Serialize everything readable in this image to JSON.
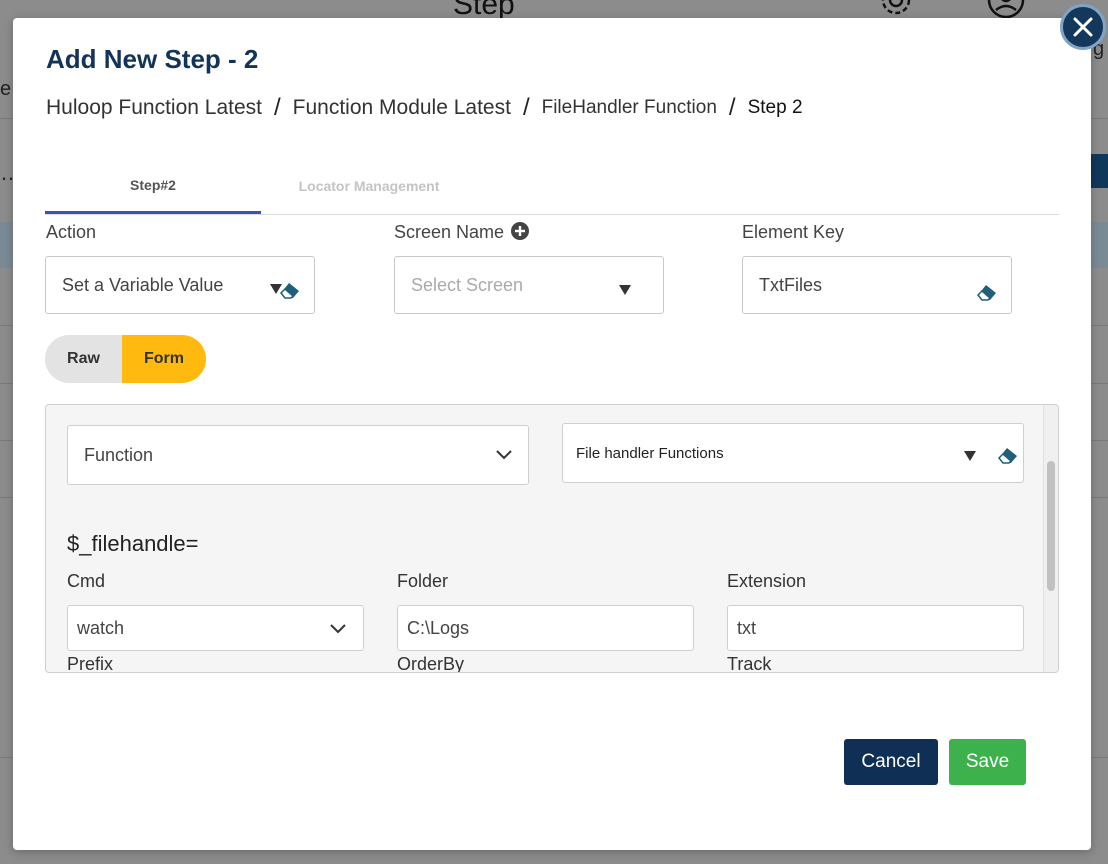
{
  "background": {
    "title": "Step",
    "letter_left": "e",
    "letter_right": "g",
    "dots": "…"
  },
  "modal": {
    "title": "Add New Step - 2",
    "breadcrumb": [
      "Huloop Function Latest",
      "Function Module Latest",
      "FileHandler Function",
      "Step 2"
    ],
    "tabs": [
      "Step#2",
      "Locator Management"
    ],
    "action": {
      "label": "Action",
      "value": "Set a Variable Value"
    },
    "screen_name": {
      "label": "Screen Name",
      "placeholder": "Select Screen"
    },
    "element_key": {
      "label": "Element Key",
      "value": "TxtFiles"
    },
    "mode_toggle": {
      "raw": "Raw",
      "form": "Form",
      "selected": "Form"
    },
    "panel": {
      "type_select": "Function",
      "function_select": "File handler Functions",
      "variable": "$_filehandle=",
      "fields": [
        {
          "label": "Cmd",
          "value": "watch",
          "kind": "select"
        },
        {
          "label": "Folder",
          "value": "C:\\Logs",
          "kind": "text"
        },
        {
          "label": "Extension",
          "value": "txt",
          "kind": "text"
        }
      ],
      "next_labels": [
        "Prefix",
        "OrderBy",
        "Track"
      ]
    },
    "buttons": {
      "cancel": "Cancel",
      "save": "Save"
    }
  },
  "colors": {
    "title": "#12335a",
    "tab_active_underline": "#3555b0",
    "toggle_selected": "#ffb90f",
    "cancel_button": "#0f2f55",
    "save_button": "#3cb14c",
    "close_button": "#13385c"
  }
}
